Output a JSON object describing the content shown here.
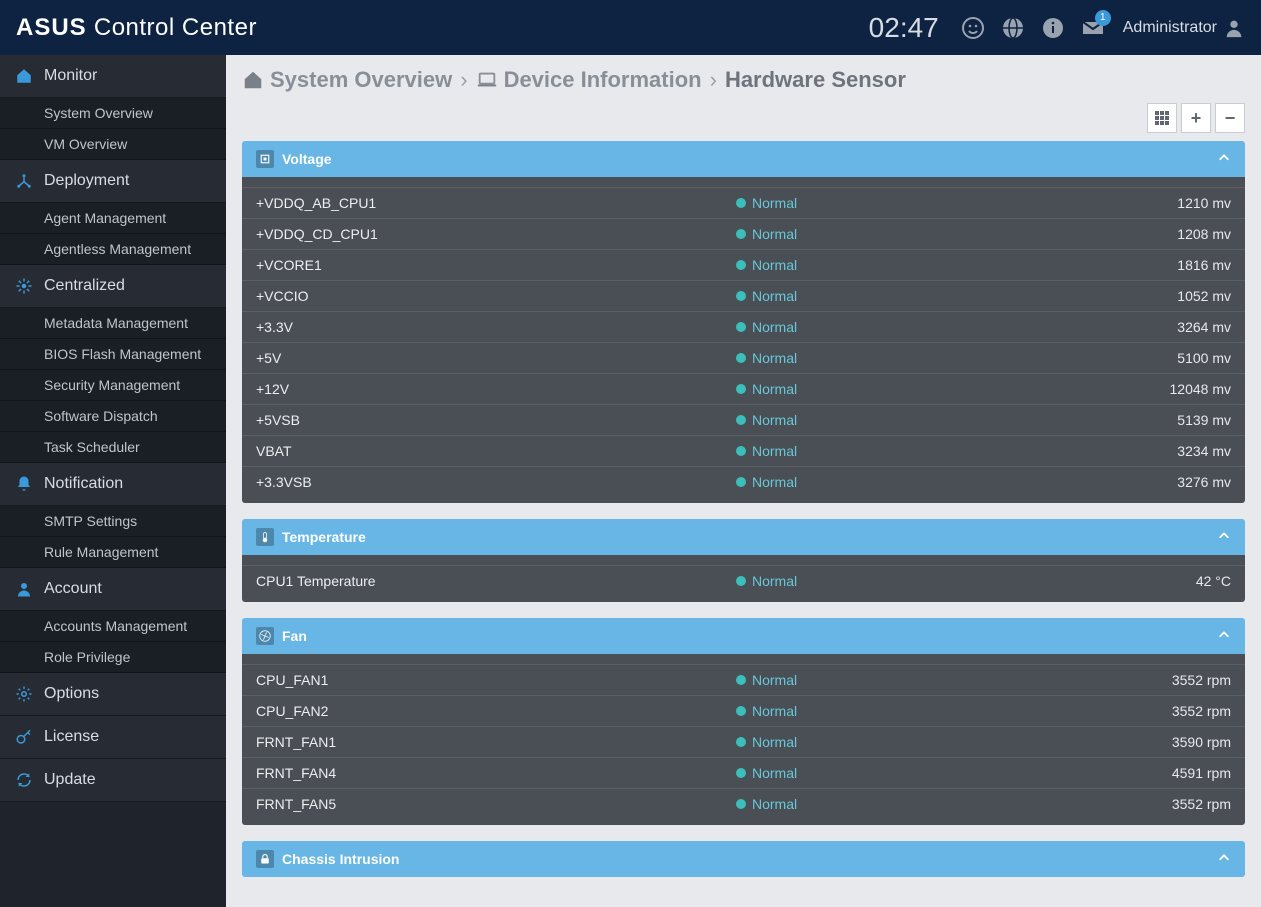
{
  "header": {
    "brand_strong": "ASUS",
    "brand_rest": "Control Center",
    "clock": "02:47",
    "user": "Administrator",
    "mail_badge": "1"
  },
  "sidebar": {
    "sections": [
      {
        "id": "monitor",
        "label": "Monitor",
        "icon": "home",
        "color": "c-blue",
        "subs": [
          {
            "id": "sysov",
            "label": "System Overview"
          },
          {
            "id": "vmov",
            "label": "VM Overview"
          }
        ]
      },
      {
        "id": "deployment",
        "label": "Deployment",
        "icon": "deploy",
        "color": "c-blue",
        "subs": [
          {
            "id": "agentm",
            "label": "Agent Management"
          },
          {
            "id": "agentless",
            "label": "Agentless Management"
          }
        ]
      },
      {
        "id": "centralized",
        "label": "Centralized",
        "icon": "central",
        "color": "c-blue",
        "subs": [
          {
            "id": "meta",
            "label": "Metadata Management"
          },
          {
            "id": "bios",
            "label": "BIOS Flash Management"
          },
          {
            "id": "sec",
            "label": "Security Management"
          },
          {
            "id": "soft",
            "label": "Software Dispatch"
          },
          {
            "id": "task",
            "label": "Task Scheduler"
          }
        ]
      },
      {
        "id": "notification",
        "label": "Notification",
        "icon": "bell",
        "color": "c-blue",
        "subs": [
          {
            "id": "smtp",
            "label": "SMTP Settings"
          },
          {
            "id": "rule",
            "label": "Rule Management"
          }
        ]
      },
      {
        "id": "account",
        "label": "Account",
        "icon": "user",
        "color": "c-blue",
        "subs": [
          {
            "id": "accs",
            "label": "Accounts Management"
          },
          {
            "id": "role",
            "label": "Role Privilege"
          }
        ]
      },
      {
        "id": "options",
        "label": "Options",
        "icon": "gear",
        "color": "c-blue",
        "subs": []
      },
      {
        "id": "license",
        "label": "License",
        "icon": "key",
        "color": "c-blue",
        "subs": []
      },
      {
        "id": "update",
        "label": "Update",
        "icon": "refresh",
        "color": "c-blue",
        "subs": []
      }
    ]
  },
  "breadcrumbs": {
    "a": "System Overview",
    "b": "Device Information",
    "c": "Hardware Sensor"
  },
  "panels": [
    {
      "id": "voltage",
      "title": "Voltage",
      "icon": "chip",
      "rows": [
        {
          "name": "+VDDQ_AB_CPU1",
          "status": "Normal",
          "value": "1210 mv"
        },
        {
          "name": "+VDDQ_CD_CPU1",
          "status": "Normal",
          "value": "1208 mv"
        },
        {
          "name": "+VCORE1",
          "status": "Normal",
          "value": "1816 mv"
        },
        {
          "name": "+VCCIO",
          "status": "Normal",
          "value": "1052 mv"
        },
        {
          "name": "+3.3V",
          "status": "Normal",
          "value": "3264 mv"
        },
        {
          "name": "+5V",
          "status": "Normal",
          "value": "5100 mv"
        },
        {
          "name": "+12V",
          "status": "Normal",
          "value": "12048 mv"
        },
        {
          "name": "+5VSB",
          "status": "Normal",
          "value": "5139 mv"
        },
        {
          "name": "VBAT",
          "status": "Normal",
          "value": "3234 mv"
        },
        {
          "name": "+3.3VSB",
          "status": "Normal",
          "value": "3276 mv"
        }
      ]
    },
    {
      "id": "temperature",
      "title": "Temperature",
      "icon": "thermo",
      "rows": [
        {
          "name": "CPU1 Temperature",
          "status": "Normal",
          "value": "42 °C"
        }
      ]
    },
    {
      "id": "fan",
      "title": "Fan",
      "icon": "fan",
      "rows": [
        {
          "name": "CPU_FAN1",
          "status": "Normal",
          "value": "3552 rpm"
        },
        {
          "name": "CPU_FAN2",
          "status": "Normal",
          "value": "3552 rpm"
        },
        {
          "name": "FRNT_FAN1",
          "status": "Normal",
          "value": "3590 rpm"
        },
        {
          "name": "FRNT_FAN4",
          "status": "Normal",
          "value": "4591 rpm"
        },
        {
          "name": "FRNT_FAN5",
          "status": "Normal",
          "value": "3552 rpm"
        }
      ]
    },
    {
      "id": "chassis",
      "title": "Chassis Intrusion",
      "icon": "lock",
      "rows": []
    }
  ]
}
